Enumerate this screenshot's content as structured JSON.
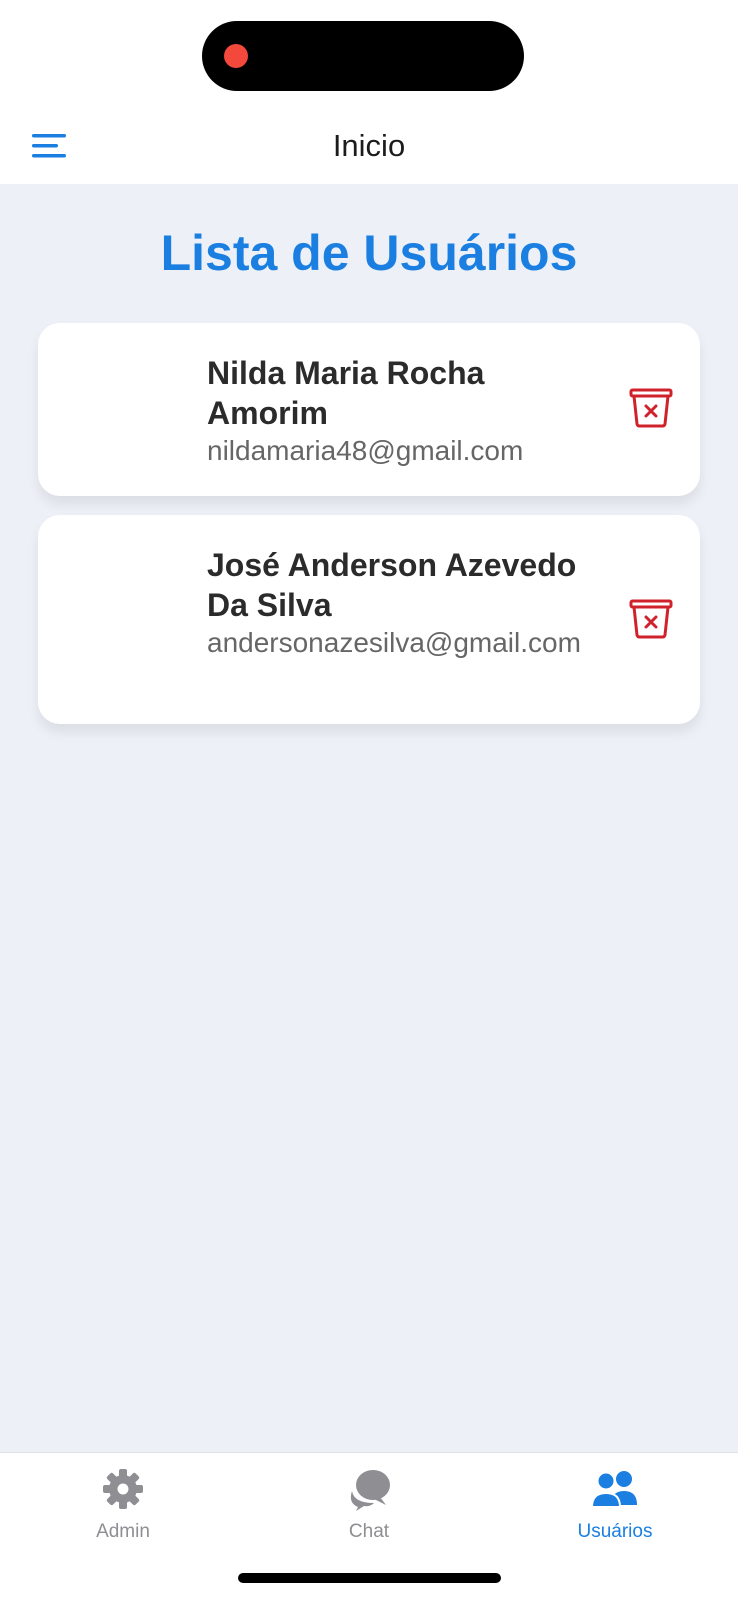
{
  "header": {
    "title": "Inicio",
    "menu_icon": "hamburger-menu-icon"
  },
  "page": {
    "title": "Lista de Usuários"
  },
  "users": [
    {
      "name": "Nilda Maria Rocha Amorim",
      "email": "nildamaria48@gmail.com",
      "action_icon": "trash-icon"
    },
    {
      "name": "José Anderson Azevedo Da Silva",
      "email": "andersonazesilva@gmail.com",
      "action_icon": "trash-icon"
    }
  ],
  "tabs": [
    {
      "label": "Admin",
      "icon": "gear-icon",
      "active": false
    },
    {
      "label": "Chat",
      "icon": "chat-bubbles-icon",
      "active": false
    },
    {
      "label": "Usuários",
      "icon": "users-icon",
      "active": true
    }
  ],
  "colors": {
    "accent": "#1a7fe0",
    "danger": "#d0222b",
    "background": "#edf1f7",
    "inactive": "#8e8e93"
  }
}
